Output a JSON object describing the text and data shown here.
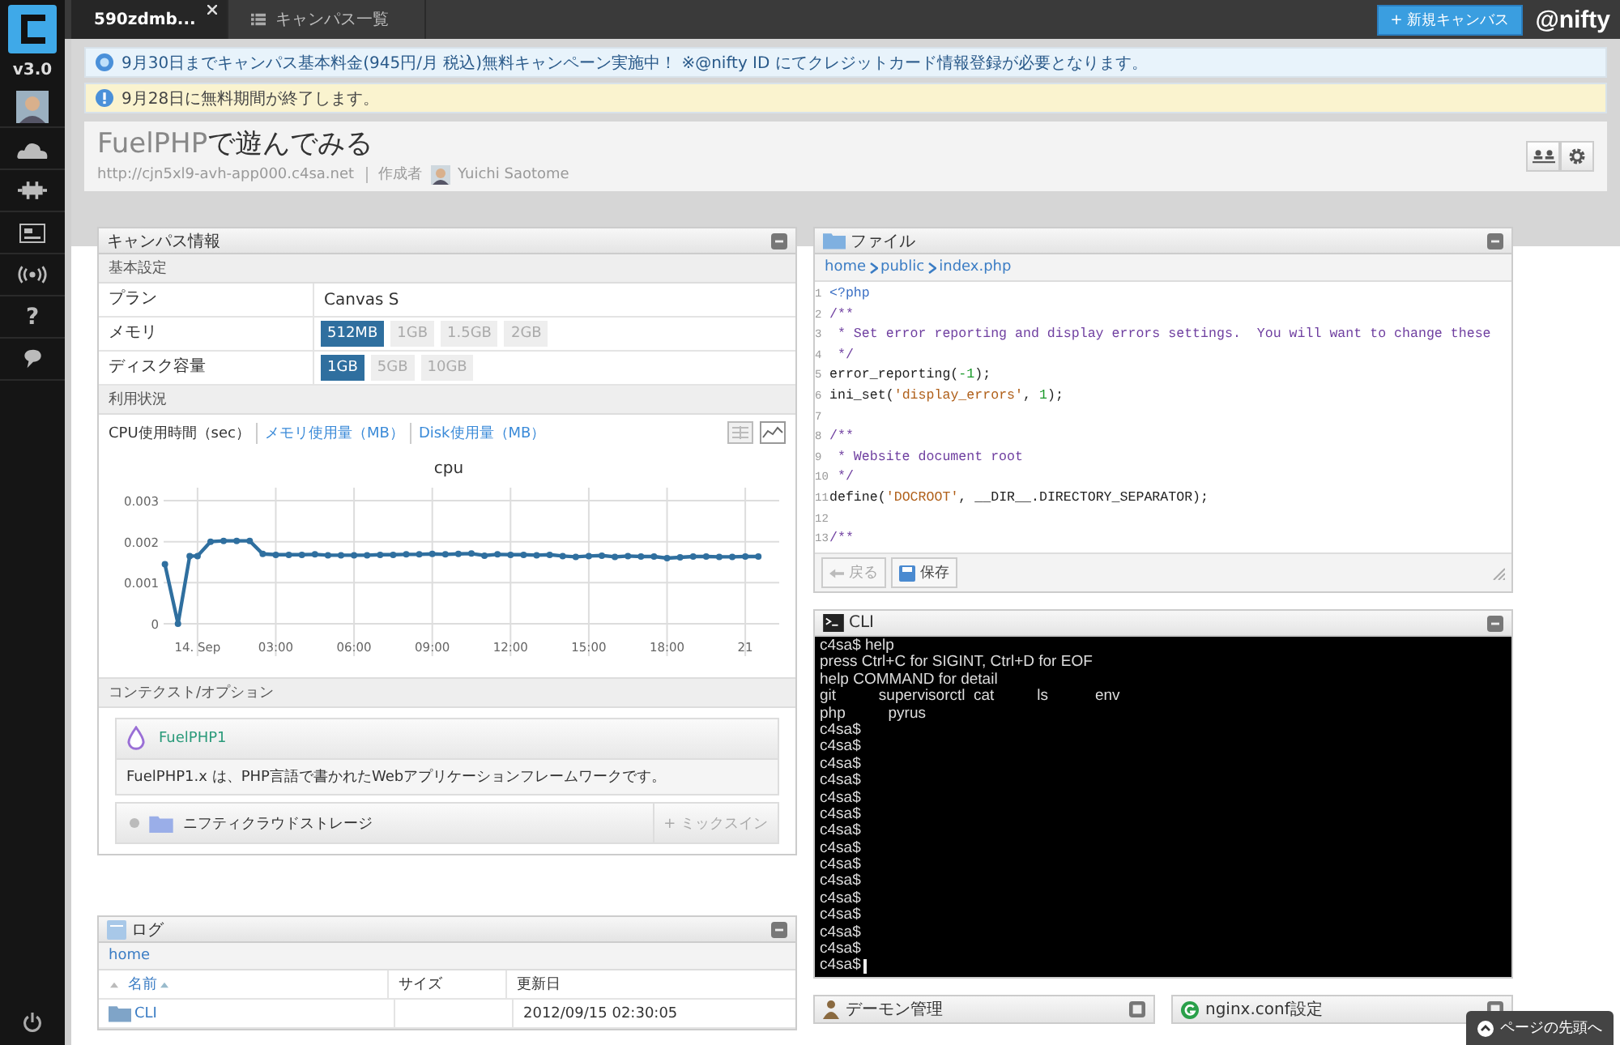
{
  "sidebar": {
    "version": "v3.0",
    "help_label": "?"
  },
  "topbar": {
    "tabs": [
      {
        "label": "590zdmb...",
        "kind": "canvas",
        "selected": true,
        "closable": true
      },
      {
        "label": "キャンパス一覧",
        "kind": "list",
        "selected": false,
        "closable": false
      }
    ],
    "new_button": "+ 新規キャンバス",
    "brand": "@nifty"
  },
  "notices": [
    {
      "kind": "info",
      "text": "9月30日までキャンパス基本料金(945円/月 税込)無料キャンペーン実施中！ ※@nifty ID にてクレジットカード情報登録が必要となります。"
    },
    {
      "kind": "warning",
      "text": "9月28日に無料期間が終了します。"
    }
  ],
  "header": {
    "title_product": "FuelPHP",
    "title_rest": "で遊んでみる",
    "url": "http://cjn5xl9-avh-app000.c4sa.net",
    "author_label": "作成者",
    "author": "Yuichi Saotome"
  },
  "canvas_info": {
    "title": "キャンパス情報",
    "basic_heading": "基本設定",
    "plan": {
      "label": "プラン",
      "value": "Canvas S"
    },
    "memory": {
      "label": "メモリ",
      "options": [
        {
          "label": "512MB",
          "selected": true
        },
        {
          "label": "1GB",
          "selected": false
        },
        {
          "label": "1.5GB",
          "selected": false
        },
        {
          "label": "2GB",
          "selected": false
        }
      ]
    },
    "disk": {
      "label": "ディスク容量",
      "options": [
        {
          "label": "1GB",
          "selected": true
        },
        {
          "label": "5GB",
          "selected": false
        },
        {
          "label": "10GB",
          "selected": false
        }
      ]
    },
    "usage": {
      "heading": "利用状況",
      "tabs": [
        {
          "label": "CPU使用時間（sec）",
          "selected": true
        },
        {
          "label": "メモリ使用量（MB）",
          "selected": false
        },
        {
          "label": "Disk使用量（MB）",
          "selected": false
        }
      ],
      "chart_data": {
        "type": "line",
        "title": "cpu",
        "x": [
          -1.25,
          -0.75,
          -0.3,
          0,
          0.5,
          1,
          1.5,
          2,
          2.5,
          3,
          3.5,
          4,
          4.5,
          5,
          5.5,
          6,
          6.5,
          7,
          7.5,
          8,
          8.5,
          9,
          9.5,
          10,
          10.5,
          11,
          11.5,
          12,
          12.5,
          13,
          13.5,
          14,
          14.5,
          15,
          15.5,
          16,
          16.5,
          17,
          17.5,
          18,
          18.5,
          19,
          19.5,
          20,
          20.5,
          21,
          21.5
        ],
        "grid": true,
        "series": [
          {
            "color": "#2f6f9f",
            "marker": "circle",
            "values": [
              0.00145,
              0,
              0.00165,
              0.00165,
              0.002,
              0.00202,
              0.00202,
              0.00202,
              0.0017,
              0.00168,
              0.00168,
              0.00168,
              0.00169,
              0.00167,
              0.00167,
              0.00167,
              0.00167,
              0.00168,
              0.00168,
              0.00169,
              0.00169,
              0.0017,
              0.00169,
              0.0017,
              0.00171,
              0.00166,
              0.00169,
              0.00168,
              0.00168,
              0.00167,
              0.00168,
              0.00165,
              0.00163,
              0.00165,
              0.00166,
              0.00163,
              0.00165,
              0.00164,
              0.00164,
              0.0016,
              0.00162,
              0.00164,
              0.00164,
              0.00163,
              0.00163,
              0.00164,
              0.00164
            ]
          }
        ],
        "xlim": [
          -1.3,
          22.3
        ],
        "ylim": [
          0,
          0.003
        ],
        "xticks": [
          {
            "value": 0,
            "label": "14. Sep"
          },
          {
            "value": 3,
            "label": "03:00"
          },
          {
            "value": 6,
            "label": "06:00"
          },
          {
            "value": 9,
            "label": "09:00"
          },
          {
            "value": 12,
            "label": "12:00"
          },
          {
            "value": 15,
            "label": "15:00"
          },
          {
            "value": 18,
            "label": "18:00"
          },
          {
            "value": 21,
            "label": "21"
          }
        ],
        "yticks": [
          {
            "value": 0,
            "label": "0"
          },
          {
            "value": 0.001,
            "label": "0.001"
          },
          {
            "value": 0.002,
            "label": "0.002"
          },
          {
            "value": 0.003,
            "label": "0.003"
          }
        ]
      }
    },
    "context_heading": "コンテクスト/オプション",
    "context": {
      "name": "FuelPHP1",
      "description": "FuelPHP1.x は、PHP言語で書かれたWebアプリケーションフレームワークです。"
    },
    "storage": {
      "label": "ニフティクラウドストレージ",
      "mixin_button": "+ ミックスイン"
    }
  },
  "log": {
    "title": "ログ",
    "breadcrumb": "home",
    "columns": [
      "名前",
      "サイズ",
      "更新日"
    ],
    "rows": [
      {
        "name": "CLI",
        "modified": "2012/09/15 02:30:05"
      }
    ]
  },
  "file": {
    "title": "ファイル",
    "breadcrumb": [
      {
        "label": "home"
      },
      {
        "label": "public"
      },
      {
        "label": "index.php"
      }
    ],
    "lines": [
      {
        "number": "1",
        "tokens": [
          {
            "text": "<?php",
            "kind": "tag"
          }
        ]
      },
      {
        "number": "2",
        "tokens": [
          {
            "text": "/**",
            "kind": "comment"
          }
        ]
      },
      {
        "number": "3",
        "tokens": [
          {
            "text": " * Set error reporting and display errors settings.  You will want to change these",
            "kind": "comment"
          }
        ]
      },
      {
        "number": "4",
        "tokens": [
          {
            "text": " */",
            "kind": "comment"
          }
        ]
      },
      {
        "number": "5",
        "tokens": [
          {
            "text": "error_reporting(",
            "kind": "plain"
          },
          {
            "text": "-1",
            "kind": "number"
          },
          {
            "text": ");",
            "kind": "plain"
          }
        ]
      },
      {
        "number": "6",
        "tokens": [
          {
            "text": "ini_set(",
            "kind": "plain"
          },
          {
            "text": "'display_errors'",
            "kind": "string"
          },
          {
            "text": ", ",
            "kind": "plain"
          },
          {
            "text": "1",
            "kind": "number"
          },
          {
            "text": ");",
            "kind": "plain"
          }
        ]
      },
      {
        "number": "7"
      },
      {
        "number": "8",
        "tokens": [
          {
            "text": "/**",
            "kind": "comment"
          }
        ]
      },
      {
        "number": "9",
        "tokens": [
          {
            "text": " * Website document root",
            "kind": "comment"
          }
        ]
      },
      {
        "number": "10",
        "tokens": [
          {
            "text": " */",
            "kind": "comment"
          }
        ]
      },
      {
        "number": "11",
        "tokens": [
          {
            "text": "define(",
            "kind": "plain"
          },
          {
            "text": "'DOCROOT'",
            "kind": "string"
          },
          {
            "text": ", __DIR__.DIRECTORY_SEPARATOR);",
            "kind": "plain"
          }
        ]
      },
      {
        "number": "12"
      },
      {
        "number": "13",
        "tokens": [
          {
            "text": "/**",
            "kind": "comment"
          }
        ]
      }
    ],
    "buttons": [
      {
        "label": "戻る",
        "kind": "back",
        "disabled": true
      },
      {
        "label": "保存",
        "kind": "save",
        "disabled": false
      }
    ]
  },
  "cli": {
    "title": "CLI",
    "lines": [
      {
        "text": "c4sa$ help",
        "cursor": false
      },
      {
        "text": "press Ctrl+C for SIGINT, Ctrl+D for EOF",
        "cursor": false
      },
      {
        "text": "help COMMAND for detail",
        "cursor": false
      },
      {
        "text": "git          supervisorctl  cat          ls           env",
        "cursor": false
      },
      {
        "text": "php          pyrus",
        "cursor": false
      },
      {
        "text": "c4sa$",
        "cursor": false
      },
      {
        "text": "c4sa$",
        "cursor": false
      },
      {
        "text": "c4sa$",
        "cursor": false
      },
      {
        "text": "c4sa$",
        "cursor": false
      },
      {
        "text": "c4sa$",
        "cursor": false
      },
      {
        "text": "c4sa$",
        "cursor": false
      },
      {
        "text": "c4sa$",
        "cursor": false
      },
      {
        "text": "c4sa$",
        "cursor": false
      },
      {
        "text": "c4sa$",
        "cursor": false
      },
      {
        "text": "c4sa$",
        "cursor": false
      },
      {
        "text": "c4sa$",
        "cursor": false
      },
      {
        "text": "c4sa$",
        "cursor": false
      },
      {
        "text": "c4sa$",
        "cursor": false
      },
      {
        "text": "c4sa$",
        "cursor": false
      },
      {
        "text": "c4sa$",
        "cursor": true
      }
    ]
  },
  "bottom_panels": [
    {
      "title": "デーモン管理",
      "kind": "daemon"
    },
    {
      "title": "nginx.conf設定",
      "kind": "nginx"
    }
  ],
  "back_to_top": "ページの先頭へ"
}
